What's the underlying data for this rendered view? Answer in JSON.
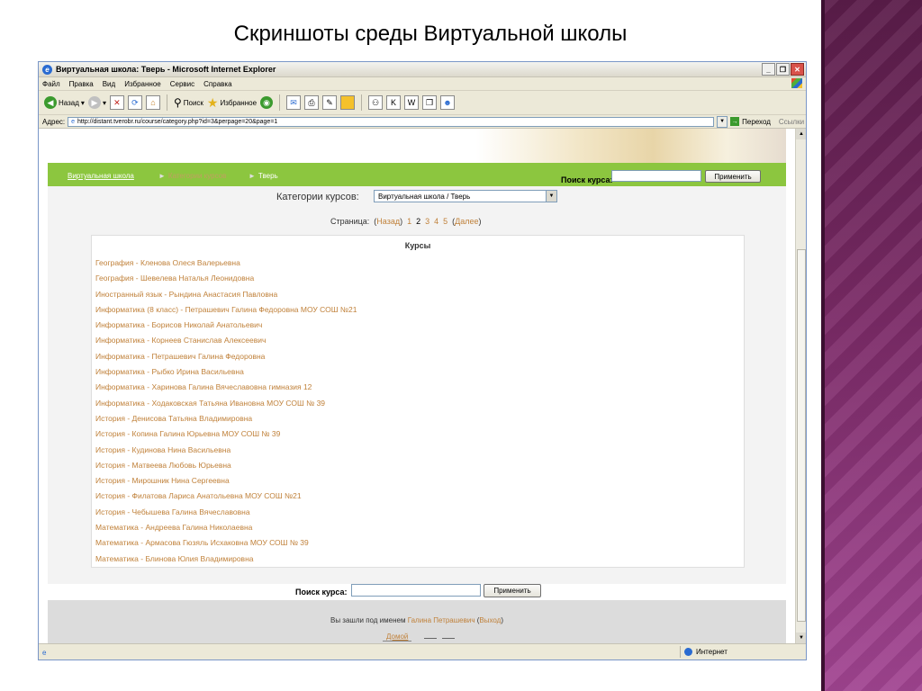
{
  "slide": {
    "title": "Скриншоты среды Виртуальной школы"
  },
  "window": {
    "title": "Виртуальная школа: Тверь - Microsoft Internet Explorer",
    "menu": [
      "Файл",
      "Правка",
      "Вид",
      "Избранное",
      "Сервис",
      "Справка"
    ],
    "toolbar": {
      "back_label": "Назад",
      "search_label": "Поиск",
      "favorites_label": "Избранное"
    },
    "address": {
      "label": "Адрес:",
      "url": "http://distant.tverobr.ru/course/category.php?id=3&perpage=20&page=1",
      "go_label": "Переход",
      "links_label": "Ссылки"
    },
    "status": {
      "zone_label": "Интернет"
    }
  },
  "page": {
    "breadcrumb": {
      "home": "Виртуальная школа",
      "categories": "Категории курсов",
      "current": "Тверь",
      "separator": "►"
    },
    "search": {
      "label": "Поиск курса:",
      "button": "Применить"
    },
    "category": {
      "label": "Категории курсов:",
      "selected": "Виртуальная школа / Тверь"
    },
    "paging": {
      "label": "Страница:",
      "prev": "Назад",
      "pages": [
        "1",
        "2",
        "3",
        "4",
        "5"
      ],
      "current": "2",
      "next": "Далее"
    },
    "courses_title": "Курсы",
    "courses": [
      "География - Кленова Олеся Валерьевна",
      "География - Шевелева Наталья Леонидовна",
      "Иностранный язык - Рындина Анастасия Павловна",
      "Информатика (8 класс) - Петрашевич Галина Федоровна МОУ СОШ №21",
      "Информатика - Борисов Николай Анатольевич",
      "Информатика - Корнеев Станислав Алексеевич",
      "Информатика - Петрашевич Галина Федоровна",
      "Информатика - Рыбко Ирина Васильевна",
      "Информатика - Харинова Галина Вячеславовна гимназия 12",
      "Информатика - Ходаковская Татьяна Ивановна МОУ СОШ № 39",
      "История - Денисова Татьяна Владимировна",
      "История - Копина Галина Юрьевна МОУ СОШ № 39",
      "История - Кудинова Нина Васильевна",
      "История - Матвеева Любовь Юрьевна",
      "История - Мирошник Нина Сергеевна",
      "История - Филатова Лариса Анатольевна МОУ СОШ №21",
      "История - Чебышева Галина Вячеславовна",
      "Математика - Андреева Галина Николаевна",
      "Математика - Армасова Гюзяль Исхаковна МОУ СОШ № 39",
      "Математика - Блинова Юлия Владимировна"
    ],
    "footer": {
      "logged_prefix": "Вы зашли под именем",
      "user": "Галина Петрашевич",
      "logout": "Выход",
      "home": "Домой"
    }
  },
  "colors": {
    "nav_green": "#8cc63f",
    "link_orange": "#c0813a",
    "strip_purple": "#7a2a66"
  }
}
